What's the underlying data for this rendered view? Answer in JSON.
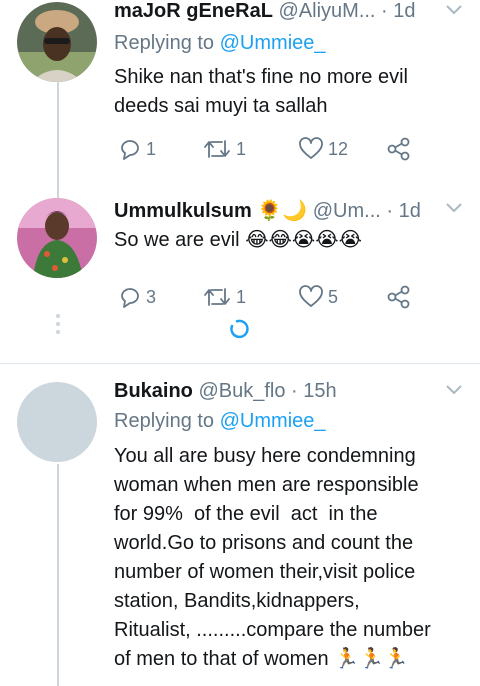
{
  "tweets": [
    {
      "name": "maJoR gEneRaL",
      "handle": "@AliyuM...",
      "time": "1d",
      "replying_prefix": "Replying to ",
      "replying_to": "@Ummiee_",
      "text": "Shike nan that's fine no more evil deeds sai muyi ta sallah",
      "replies": "1",
      "retweets": "1",
      "likes": "12"
    },
    {
      "name": "Ummulkulsum",
      "name_emoji": "🌻🌙",
      "handle": "@Um...",
      "time": "1d",
      "text": "So we are evil",
      "text_emoji": "😂😂😭😭😭",
      "replies": "3",
      "retweets": "1",
      "likes": "5"
    },
    {
      "name": "Bukaino",
      "handle": "@Buk_flo",
      "time": "15h",
      "replying_prefix": "Replying to ",
      "replying_to": "@Ummiee_",
      "text_lines": [
        "You all are busy here condemning",
        "woman when men are responsible",
        "for 99%  of the evil  act  in the",
        "world.Go to prisons and count the",
        "number of women their,visit police",
        "station, Bandits,kidnappers,",
        "Ritualist, .........compare the number",
        "of men to that of women"
      ],
      "text_emoji": "🏃🏃🏃"
    }
  ],
  "separator": "·",
  "colors": {
    "link": "#1da1f2",
    "secondary": "#657786",
    "divider": "#e1e8ed",
    "thread_line": "#ccd6dd"
  },
  "icons": {
    "reply": "reply-icon",
    "retweet": "retweet-icon",
    "like": "heart-icon",
    "share": "share-icon",
    "menu": "chevron-down-icon",
    "loading": "loading-spinner-icon"
  }
}
